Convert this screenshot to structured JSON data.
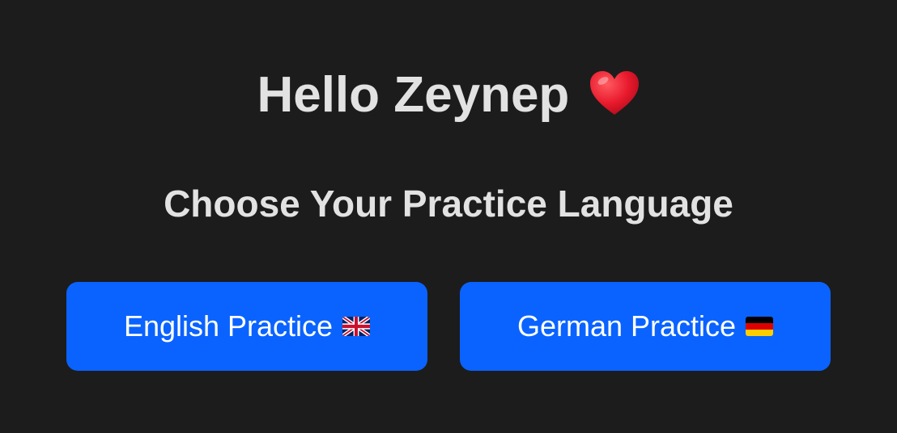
{
  "greeting": {
    "text": "Hello Zeynep",
    "emoji_icon": "red-heart-icon"
  },
  "subtitle": "Choose Your Practice Language",
  "buttons": [
    {
      "label": "English Practice",
      "flag_icon": "uk-flag-icon"
    },
    {
      "label": "German Practice",
      "flag_icon": "germany-flag-icon"
    }
  ],
  "colors": {
    "background": "#1c1c1c",
    "text": "#e2e2e2",
    "button": "#0a63ff",
    "button_text": "#ffffff",
    "heart": "#e8192c"
  }
}
